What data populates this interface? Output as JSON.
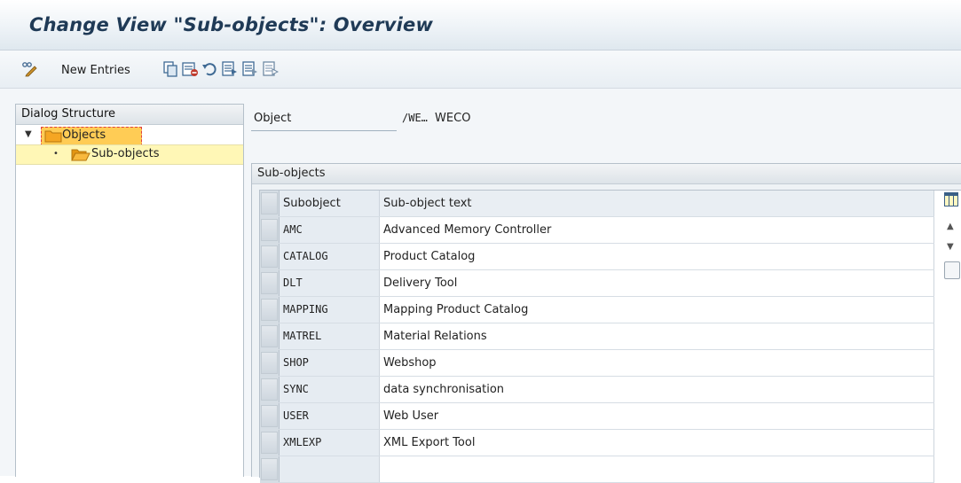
{
  "window": {
    "title": "Change View \"Sub-objects\": Overview"
  },
  "toolbar": {
    "new_entries_label": "New Entries",
    "icons": [
      "display-change-icon",
      "copy-icon",
      "delete-icon",
      "undo-icon",
      "select-all-icon",
      "select-block-icon",
      "deselect-all-icon"
    ]
  },
  "dialog_structure": {
    "header": "Dialog Structure",
    "items": [
      {
        "label": "Objects",
        "level": 0,
        "expanded": true,
        "focused": true
      },
      {
        "label": "Sub-objects",
        "level": 1,
        "selected": true
      }
    ]
  },
  "object_field": {
    "label": "Object",
    "value_code": "/WE…",
    "value_text": "WECO"
  },
  "subobjects": {
    "group_title": "Sub-objects",
    "columns": [
      "Subobject",
      "Sub-object text"
    ],
    "rows": [
      {
        "key": "AMC",
        "text": "Advanced Memory Controller"
      },
      {
        "key": "CATALOG",
        "text": "Product Catalog"
      },
      {
        "key": "DLT",
        "text": "Delivery Tool"
      },
      {
        "key": "MAPPING",
        "text": "Mapping Product Catalog"
      },
      {
        "key": "MATREL",
        "text": "Material Relations"
      },
      {
        "key": "SHOP",
        "text": "Webshop"
      },
      {
        "key": "SYNC",
        "text": "data synchronisation"
      },
      {
        "key": "USER",
        "text": "Web User"
      },
      {
        "key": "XMLEXP",
        "text": "XML Export Tool"
      }
    ]
  },
  "colors": {
    "title": "#1f3a56",
    "selected_row": "#fff7b6",
    "focus_border": "#e04040",
    "folder": "#f5a623"
  }
}
